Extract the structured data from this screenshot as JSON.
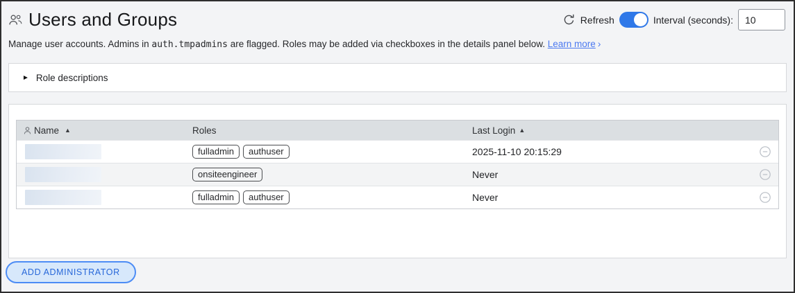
{
  "page": {
    "title": "Users and Groups"
  },
  "toolbar": {
    "refresh_label": "Refresh",
    "refresh_enabled": true,
    "interval_label": "Interval (seconds):",
    "interval_value": "10"
  },
  "description": {
    "part1": "Manage user accounts. Admins in ",
    "code": "auth.tmpadmins",
    "part2": " are flagged. Roles may be added via checkboxes in the details panel below. ",
    "link_label": "Learn more",
    "link_chevron": "›"
  },
  "accordion": {
    "collapsed_marker": "►",
    "label": "Role descriptions"
  },
  "table": {
    "columns": [
      {
        "label": "Name",
        "sort_indicator": "▲"
      },
      {
        "label": "Roles",
        "sort_indicator": ""
      },
      {
        "label": "Last Login",
        "sort_indicator": "▲"
      }
    ],
    "rows": [
      {
        "name_redacted": true,
        "roles": [
          "fulladmin",
          "authuser"
        ],
        "last_login": "2025-11-10 20:15:29"
      },
      {
        "name_redacted": true,
        "roles": [
          "onsiteengineer"
        ],
        "last_login": "Never"
      },
      {
        "name_redacted": true,
        "roles": [
          "fulladmin",
          "authuser"
        ],
        "last_login": "Never"
      }
    ]
  },
  "actions": {
    "add_administrator_label": "ADD ADMINISTRATOR"
  },
  "colors": {
    "toggle_on": "#2f78e8",
    "link_blue": "#4b79f0",
    "table_header_bg": "#dbdfe2",
    "button_bg": "#d7e8fb",
    "button_border": "#4c8cf5",
    "button_text": "#2767d9",
    "redacted_fill": "#d9e3ef"
  }
}
